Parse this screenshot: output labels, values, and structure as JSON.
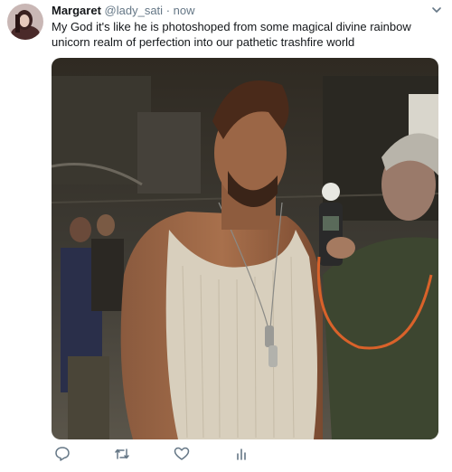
{
  "tweet": {
    "author_name": "Margaret",
    "handle": "@lady_sati",
    "separator": "·",
    "timestamp": "now",
    "text": "My God it's like he is photoshoped from some magical divine rainbow unicorn realm of perfection into our pathetic trashfire world"
  },
  "icons": {
    "caret": "chevron-down-icon",
    "reply": "reply-icon",
    "retweet": "retweet-icon",
    "like": "heart-icon",
    "analytics": "analytics-icon"
  },
  "colors": {
    "text": "#14171a",
    "secondary": "#657786",
    "icon": "#657786"
  }
}
